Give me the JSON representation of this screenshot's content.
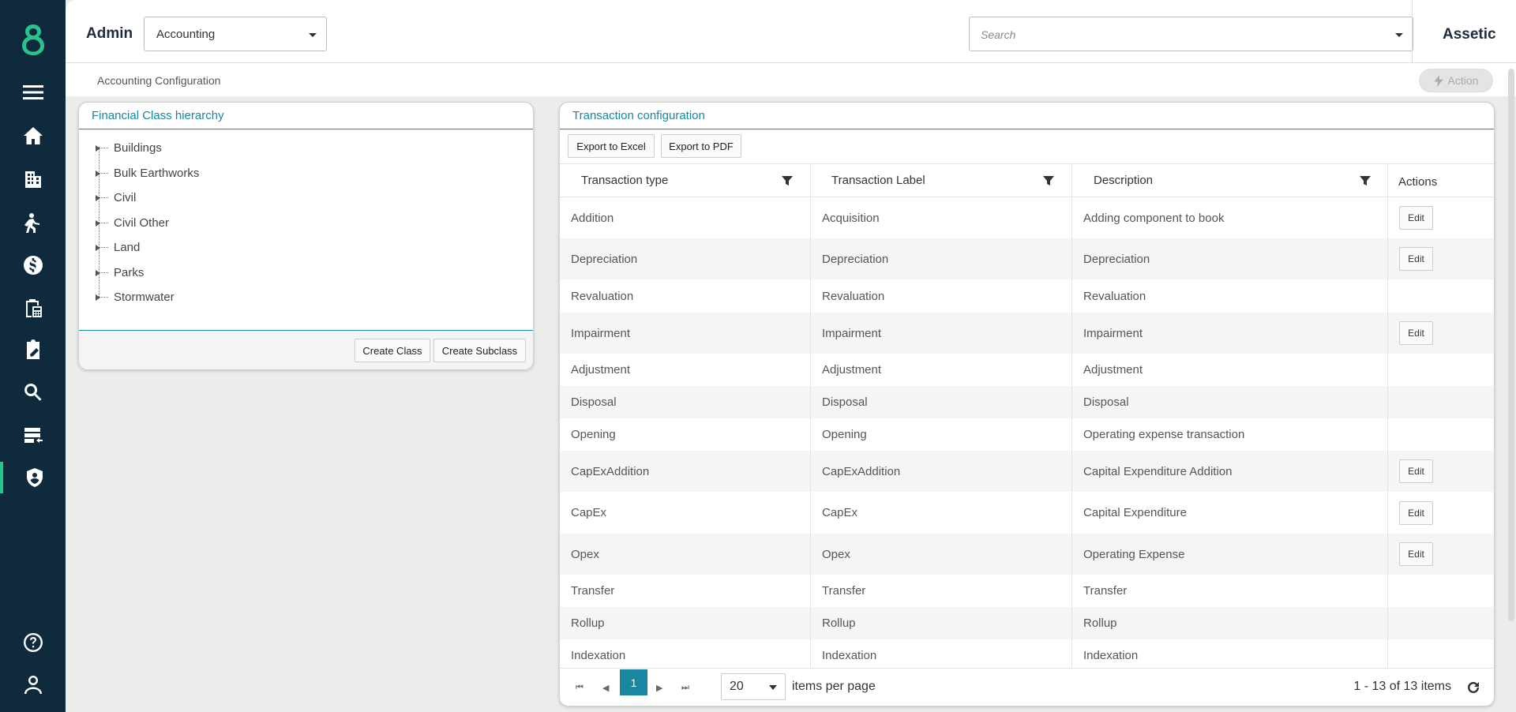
{
  "sidebar": {
    "icons": [
      "logo-icon",
      "menu-icon",
      "home-icon",
      "buildings-icon",
      "worker-icon",
      "finance-icon",
      "clipboard-calc-icon",
      "clipboard-edit-icon",
      "search-icon",
      "server-icon",
      "shield-icon",
      "help-icon",
      "user-icon"
    ],
    "active": "shield-icon"
  },
  "header": {
    "admin_label": "Admin",
    "module_select": "Accounting",
    "search_placeholder": "Search",
    "brand": "Assetic"
  },
  "subheader": {
    "title": "Accounting Configuration",
    "action_label": "Action"
  },
  "tree_panel": {
    "title": "Financial Class hierarchy",
    "items": [
      "Buildings",
      "Bulk Earthworks",
      "Civil",
      "Civil Other",
      "Land",
      "Parks",
      "Stormwater"
    ],
    "create_class_label": "Create Class",
    "create_subclass_label": "Create Subclass"
  },
  "tx_panel": {
    "title": "Transaction configuration",
    "export_excel_label": "Export to Excel",
    "export_pdf_label": "Export to PDF",
    "columns": [
      "Transaction type",
      "Transaction Label",
      "Description",
      "Actions"
    ],
    "edit_label": "Edit",
    "rows": [
      {
        "type": "Addition",
        "label": "Acquisition",
        "description": "Adding component to book",
        "edit": true
      },
      {
        "type": "Depreciation",
        "label": "Depreciation",
        "description": "Depreciation",
        "edit": true
      },
      {
        "type": "Revaluation",
        "label": "Revaluation",
        "description": "Revaluation",
        "edit": false
      },
      {
        "type": "Impairment",
        "label": "Impairment",
        "description": "Impairment",
        "edit": true
      },
      {
        "type": "Adjustment",
        "label": "Adjustment",
        "description": "Adjustment",
        "edit": false
      },
      {
        "type": "Disposal",
        "label": "Disposal",
        "description": "Disposal",
        "edit": false
      },
      {
        "type": "Opening",
        "label": "Opening",
        "description": "Operating expense transaction",
        "edit": false
      },
      {
        "type": "CapExAddition",
        "label": "CapExAddition",
        "description": "Capital Expenditure Addition",
        "edit": true
      },
      {
        "type": "CapEx",
        "label": "CapEx",
        "description": "Capital Expenditure",
        "edit": true
      },
      {
        "type": "Opex",
        "label": "Opex",
        "description": "Operating Expense",
        "edit": true
      },
      {
        "type": "Transfer",
        "label": "Transfer",
        "description": "Transfer",
        "edit": false
      },
      {
        "type": "Rollup",
        "label": "Rollup",
        "description": "Rollup",
        "edit": false
      },
      {
        "type": "Indexation",
        "label": "Indexation",
        "description": "Indexation",
        "edit": false
      }
    ],
    "pager": {
      "current_page": "1",
      "page_size": "20",
      "items_per_page_label": "items per page",
      "info": "1 - 13 of 13 items"
    }
  },
  "colors": {
    "sidebar_bg": "#0f2a3d",
    "accent": "#1b86a0",
    "active_marker": "#27c58c"
  }
}
